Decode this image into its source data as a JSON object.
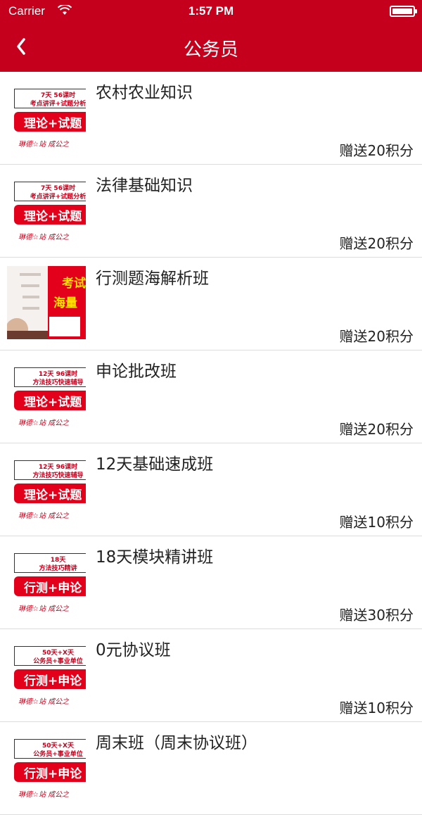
{
  "status_bar": {
    "carrier": "Carrier",
    "time": "1:57 PM"
  },
  "nav": {
    "title": "公务员"
  },
  "courses": [
    {
      "name": "农村农业知识",
      "points": "赠送20积分",
      "thumb": {
        "type": "poster",
        "line1": "7天 56课时",
        "line2": "考点讲评+试题分析",
        "banner": "理论+试题",
        "brand": "琳德☆站    成公之"
      }
    },
    {
      "name": "法律基础知识",
      "points": "赠送20积分",
      "thumb": {
        "type": "poster",
        "line1": "7天 56课时",
        "line2": "考点讲评+试题分析",
        "banner": "理论+试题",
        "brand": "琳德☆站    成公之"
      }
    },
    {
      "name": "行测题海解析班",
      "points": "赠送20积分",
      "thumb": {
        "type": "photo",
        "text1": "考试",
        "text2": "海量"
      }
    },
    {
      "name": "申论批改班",
      "points": "赠送20积分",
      "thumb": {
        "type": "poster",
        "line1": "12天 96课时",
        "line2": "方法技巧快速辅导",
        "banner": "理论+试题",
        "brand": "琳德☆站    成公之"
      }
    },
    {
      "name": "12天基础速成班",
      "points": "赠送10积分",
      "thumb": {
        "type": "poster",
        "line1": "12天 96课时",
        "line2": "方法技巧快速辅导",
        "banner": "理论+试题",
        "brand": "琳德☆站    成公之"
      }
    },
    {
      "name": "18天模块精讲班",
      "points": "赠送30积分",
      "thumb": {
        "type": "poster",
        "line1": "18天",
        "line2": "方法技巧精讲",
        "banner": "行测+申论",
        "brand": "琳德☆站    成公之"
      }
    },
    {
      "name": "0元协议班",
      "points": "赠送10积分",
      "thumb": {
        "type": "poster",
        "line1": "50天+X天",
        "line2": "公务员+事业单位",
        "banner": "行测+申论",
        "brand": "琳德☆站    成公之"
      }
    },
    {
      "name": "周末班（周末协议班）",
      "points": "",
      "thumb": {
        "type": "poster",
        "line1": "50天+X天",
        "line2": "公务员+事业单位",
        "banner": "行测+申论",
        "brand": "琳德☆站    成公之"
      }
    }
  ],
  "colors": {
    "header": "#c4001c",
    "banner_red": "#e3001b",
    "divider": "#dcdcdc"
  },
  "icons": {
    "back": "chevron-left-icon",
    "wifi": "wifi-icon",
    "battery": "battery-icon"
  }
}
